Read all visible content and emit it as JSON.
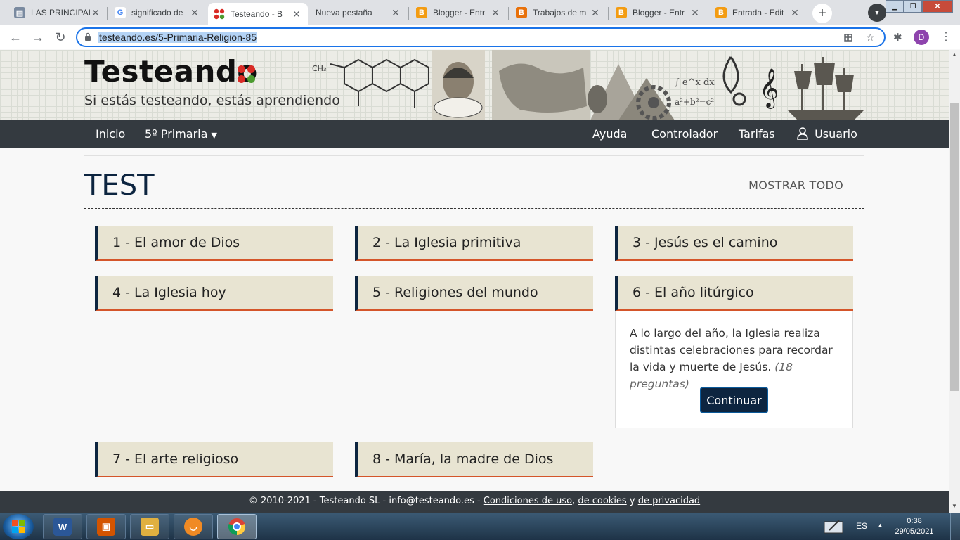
{
  "browser": {
    "tabs": [
      {
        "title": "LAS PRINCIPALES",
        "icon": "document-icon",
        "color": "#7a8aa0"
      },
      {
        "title": "significado de",
        "icon": "google-icon",
        "color": "#4285f4"
      },
      {
        "title": "Testeando - B",
        "icon": "testeando-icon",
        "color": "#d92b26",
        "active": true
      },
      {
        "title": "Nueva pestaña",
        "icon": "none"
      },
      {
        "title": "Blogger - Entr",
        "icon": "blogger-icon",
        "color": "#f39c12"
      },
      {
        "title": "Trabajos de m",
        "icon": "blogger-icon",
        "color": "#e8710a"
      },
      {
        "title": "Blogger - Entr",
        "icon": "blogger-icon",
        "color": "#f39c12"
      },
      {
        "title": "Entrada - Edit",
        "icon": "blogger-icon",
        "color": "#f39c12"
      }
    ],
    "tab_close": "✕",
    "new_tab": "+",
    "url": "testeando.es/5-Primaria-Religion-85",
    "profile_initial": "D"
  },
  "site": {
    "logo": "Testeando",
    "slogan": "Si estás testeando, estás aprendiendo",
    "nav": {
      "home": "Inicio",
      "grade": "5º Primaria",
      "help": "Ayuda",
      "controller": "Controlador",
      "prices": "Tarifas",
      "user": "Usuario"
    },
    "page_title": "TEST",
    "show_all": "MOSTRAR TODO",
    "cards": [
      {
        "title": "1 - El amor de Dios"
      },
      {
        "title": "2 - La Iglesia primitiva"
      },
      {
        "title": "3 - Jesús es el camino"
      },
      {
        "title": "4 - La Iglesia hoy"
      },
      {
        "title": "5 - Religiones del mundo"
      },
      {
        "title": "6 - El año litúrgico"
      },
      {
        "title": "7 - El arte religioso"
      },
      {
        "title": "8 - María, la madre de Dios"
      }
    ],
    "expanded": {
      "description": "A lo largo del año, la Iglesia realiza distintas celebraciones para recordar la vida y muerte de Jesús.",
      "count": "(18 preguntas)",
      "button": "Continuar"
    },
    "footer": {
      "copy": "© 2010-2021 - Testeando SL - info@testeando.es - ",
      "terms": "Condiciones de uso",
      "sep1": ", ",
      "cookies": "de cookies",
      "sep2": " y ",
      "privacy": "de privacidad"
    }
  },
  "taskbar": {
    "apps": [
      {
        "name": "word",
        "label": "W",
        "color": "#2b5797"
      },
      {
        "name": "app-orange",
        "label": "",
        "color": "#d35400"
      },
      {
        "name": "explorer",
        "label": "",
        "color": "#e0b040"
      },
      {
        "name": "uc-browser",
        "label": "",
        "color": "#f08a24"
      },
      {
        "name": "chrome",
        "label": "",
        "color": "#4285f4",
        "active": true
      }
    ],
    "language": "ES",
    "time": "0:38",
    "date": "29/05/2021"
  },
  "colors": {
    "navy": "#0d2540",
    "card_bg": "#e8e4d2",
    "card_accent": "#d4552a",
    "navbar": "#343a40"
  }
}
